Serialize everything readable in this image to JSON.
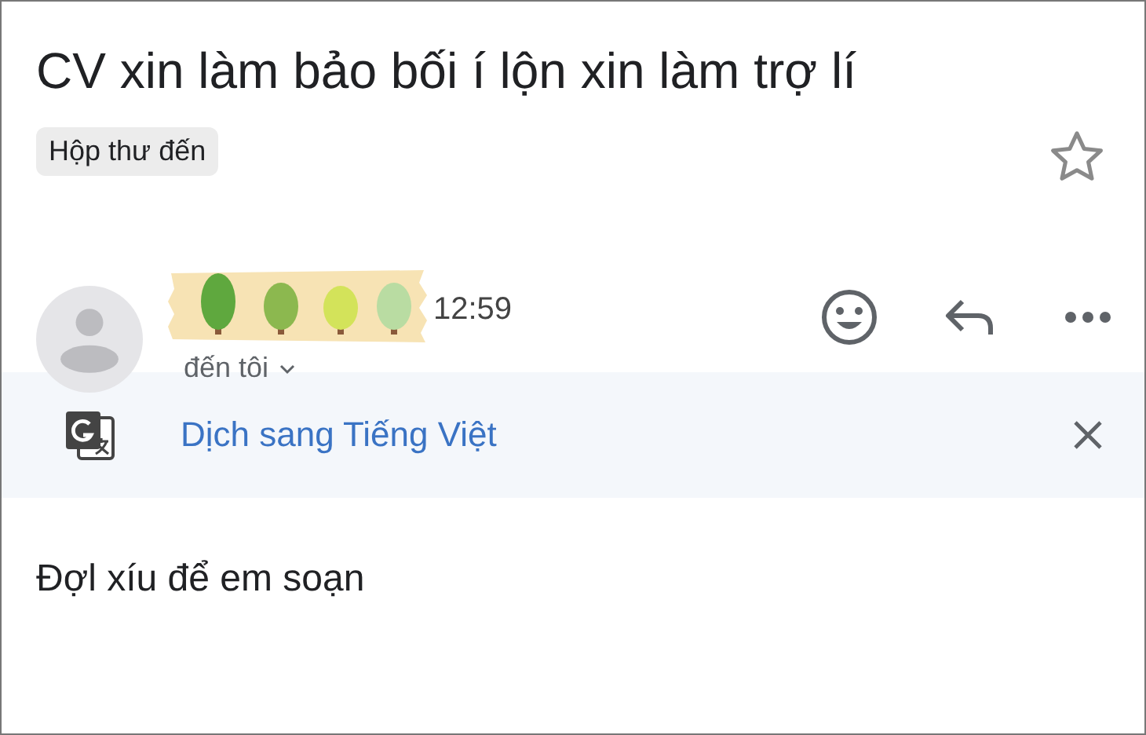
{
  "subject": "CV xin làm bảo bối í lộn xin làm trợ lí",
  "label": "Hộp thư đến",
  "starred": false,
  "message": {
    "time": "12:59",
    "recipient": "đến tôi"
  },
  "translate_banner": {
    "link": "Dịch sang Tiếng Việt"
  },
  "body": "Đợl xíu để em soạn"
}
